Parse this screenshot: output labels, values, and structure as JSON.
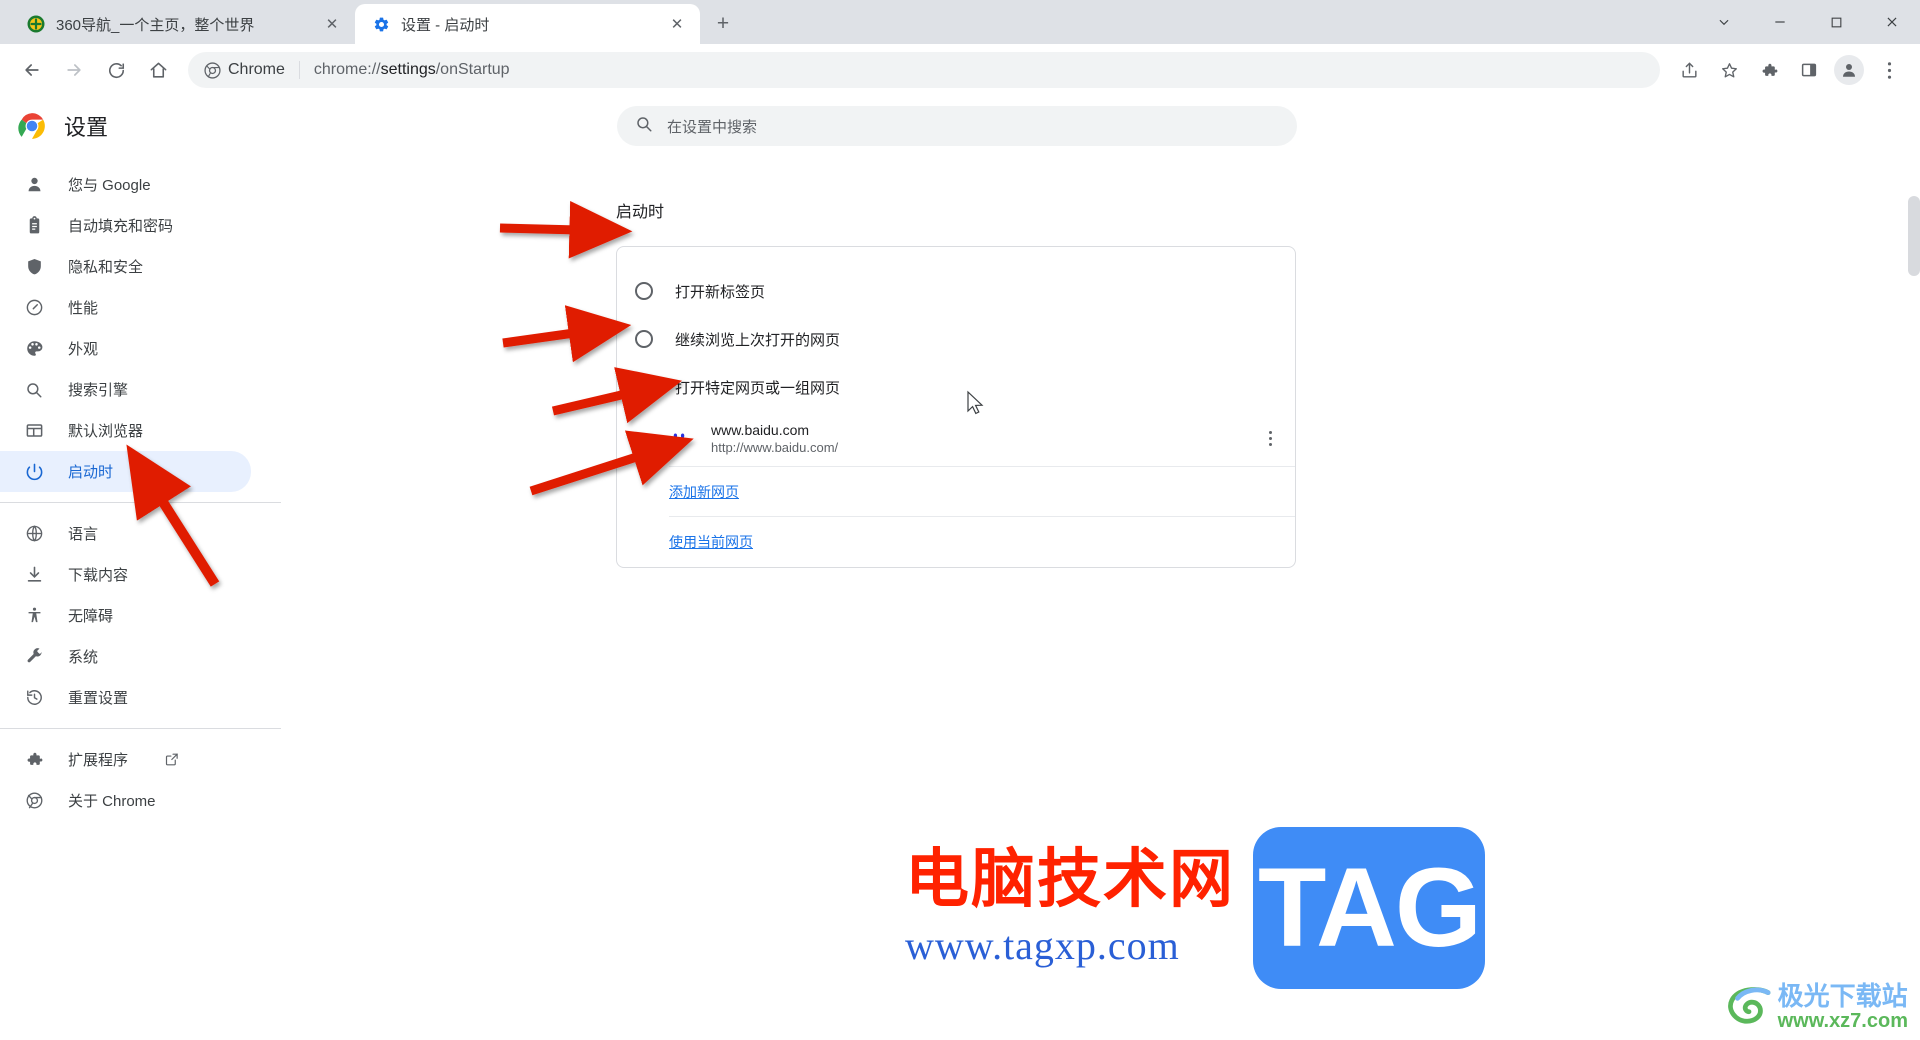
{
  "window": {
    "controls": {
      "minimize_label": "—",
      "maximize_label": "□",
      "close_label": "✕",
      "chevron_label": "∨"
    }
  },
  "tabs": [
    {
      "title": "360导航_一个主页，整个世界",
      "favicon": "360-icon",
      "active": false,
      "close_label": "✕"
    },
    {
      "title": "设置 - 启动时",
      "favicon": "gear-icon",
      "active": true,
      "close_label": "✕"
    }
  ],
  "newtab_label": "+",
  "toolbar": {
    "back_label": "←",
    "forward_label": "→",
    "reload_label": "↻",
    "home_label": "⌂",
    "omnibox": {
      "chip_label": "Chrome",
      "url_scheme": "chrome://",
      "url_host": "settings",
      "url_path": "/onStartup",
      "url_full": "chrome://settings/onStartup"
    },
    "icons": [
      {
        "name": "share-icon"
      },
      {
        "name": "bookmark-star-icon"
      },
      {
        "name": "extensions-puzzle-icon"
      },
      {
        "name": "side-panel-icon"
      },
      {
        "name": "profile-avatar-icon"
      },
      {
        "name": "three-dot-menu-icon"
      }
    ]
  },
  "settings": {
    "brand_title": "设置",
    "search": {
      "placeholder": "在设置中搜索",
      "value": "",
      "icon": "search-icon"
    },
    "sidebar": {
      "items": [
        {
          "label": "您与 Google",
          "icon": "person-icon",
          "selected": false
        },
        {
          "label": "自动填充和密码",
          "icon": "clipboard-icon",
          "selected": false
        },
        {
          "label": "隐私和安全",
          "icon": "shield-icon",
          "selected": false
        },
        {
          "label": "性能",
          "icon": "speedometer-icon",
          "selected": false
        },
        {
          "label": "外观",
          "icon": "palette-icon",
          "selected": false
        },
        {
          "label": "搜索引擎",
          "icon": "search-icon",
          "selected": false
        },
        {
          "label": "默认浏览器",
          "icon": "browser-window-icon",
          "selected": false
        },
        {
          "label": "启动时",
          "icon": "power-icon",
          "selected": true
        }
      ],
      "group2": [
        {
          "label": "语言",
          "icon": "globe-icon"
        },
        {
          "label": "下载内容",
          "icon": "download-icon"
        },
        {
          "label": "无障碍",
          "icon": "accessibility-icon"
        },
        {
          "label": "系统",
          "icon": "wrench-icon"
        },
        {
          "label": "重置设置",
          "icon": "restore-history-icon"
        }
      ],
      "group3": [
        {
          "label": "扩展程序",
          "icon": "puzzle-icon",
          "external": true,
          "external_icon": "open-in-new-icon"
        },
        {
          "label": "关于 Chrome",
          "icon": "chrome-logo-icon",
          "external": false
        }
      ]
    },
    "main": {
      "section_title": "启动时",
      "options": [
        {
          "label": "打开新标签页",
          "checked": false
        },
        {
          "label": "继续浏览上次打开的网页",
          "checked": false
        },
        {
          "label": "打开特定网页或一组网页",
          "checked": true
        }
      ],
      "startup_sites": [
        {
          "name": "www.baidu.com",
          "url": "http://www.baidu.com/",
          "favicon": "baidu-paw-icon",
          "menu_icon": "three-dot-menu-icon"
        }
      ],
      "add_page_link": "添加新网页",
      "use_current_link": "使用当前网页"
    }
  },
  "watermarks": {
    "center": {
      "cn_text": "电脑技术网",
      "url_text": "www.tagxp.com",
      "badge_text": "TAG",
      "cn_color": "#ff2200",
      "url_color": "#2a5fd6",
      "badge_bg": "#3f8cf6"
    },
    "bottom_right": {
      "cn_text": "极光下载站",
      "url_text": "www.xz7.com",
      "cn_color": "#7ab8f5",
      "url_color": "#5bb85b"
    }
  },
  "annotations": {
    "arrow_color": "#e01b00",
    "arrow_count": 4,
    "cursor": "arrow-pointer"
  }
}
